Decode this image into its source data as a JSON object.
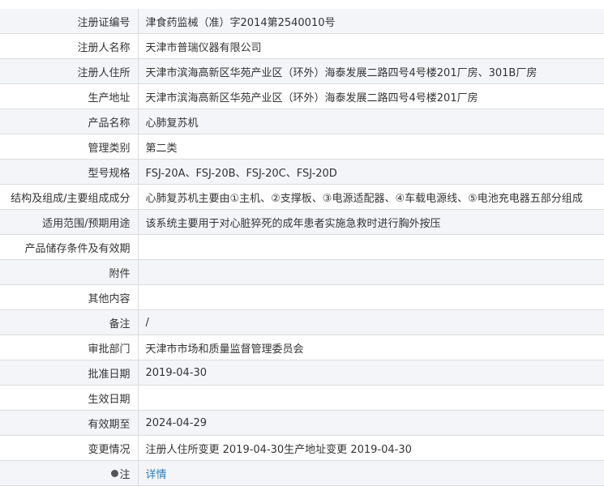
{
  "rows": [
    {
      "label": "注册证编号",
      "value": "津食药监械（准）字2014第2540010号"
    },
    {
      "label": "注册人名称",
      "value": "天津市普瑞仪器有限公司"
    },
    {
      "label": "注册人住所",
      "value": "天津市滨海高新区华苑产业区（环外）海泰发展二路四号4号楼201厂房、301B厂房"
    },
    {
      "label": "生产地址",
      "value": "天津市滨海高新区华苑产业区（环外）海泰发展二路四号4号楼201厂房"
    },
    {
      "label": "产品名称",
      "value": "心肺复苏机"
    },
    {
      "label": "管理类别",
      "value": "第二类"
    },
    {
      "label": "型号规格",
      "value": "FSJ-20A、FSJ-20B、FSJ-20C、FSJ-20D"
    },
    {
      "label": "结构及组成/主要组成成分",
      "value": "心肺复苏机主要由①主机、②支撑板、③电源适配器、④车载电源线、⑤电池充电器五部分组成"
    },
    {
      "label": "适用范围/预期用途",
      "value": "该系统主要用于对心脏猝死的成年患者实施急救时进行胸外按压"
    },
    {
      "label": "产品储存条件及有效期",
      "value": ""
    },
    {
      "label": "附件",
      "value": ""
    },
    {
      "label": "其他内容",
      "value": ""
    },
    {
      "label": "备注",
      "value": "/"
    },
    {
      "label": "审批部门",
      "value": "天津市市场和质量监督管理委员会"
    },
    {
      "label": "批准日期",
      "value": "2019-04-30"
    },
    {
      "label": "生效日期",
      "value": ""
    },
    {
      "label": "有效期至",
      "value": "2024-04-29"
    },
    {
      "label": "变更情况",
      "value": "注册人住所变更 2019-04-30生产地址变更 2019-04-30"
    }
  ],
  "note": {
    "label": "注",
    "icon": "dot-icon",
    "link_text": "详情",
    "link_color": "#2a7ab8"
  },
  "colors": {
    "alt_row": "#f3f5f8",
    "border": "#dcdcdc",
    "text": "#333333"
  }
}
